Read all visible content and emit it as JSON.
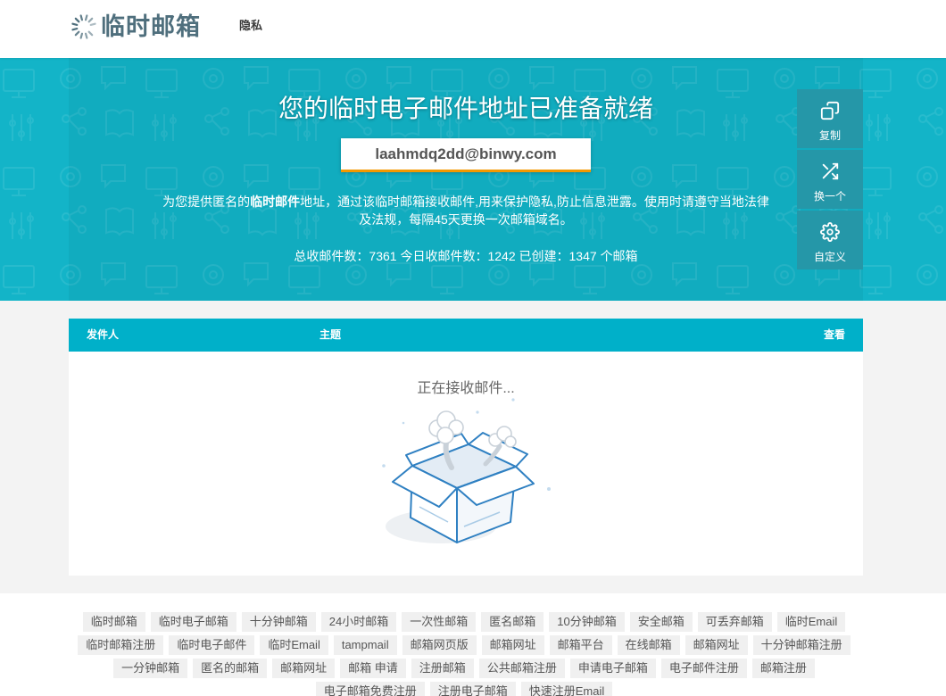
{
  "theme": {
    "accent": "#00b0c9",
    "hero_bg": "#13b4c8",
    "action_bg": "#2597a8",
    "email_underline": "#f39800",
    "logo_color": "#4f6f7d",
    "section_bg": "#f3f3f3",
    "tag_bg": "#f0f0f0"
  },
  "header": {
    "logo": {
      "text": "临时邮箱",
      "icon": "logo-spinner-icon"
    },
    "nav": [
      {
        "label": "隐私"
      }
    ]
  },
  "hero": {
    "title": "您的临时电子邮件地址已准备就绪",
    "email_address": "laahmdq2dd@binwy.com",
    "description": {
      "before": "为您提供匿名的",
      "highlight": "临时邮件",
      "after": "地址，通过该临时邮箱接收邮件,用来保护隐私,防止信息泄露。使用时请遵守当地法律及法规，每隔45天更换一次邮箱域名。"
    },
    "stats": {
      "total_label": "总收邮件数：",
      "total": "7361",
      "today_label": "今日收邮件数：",
      "today": "1242",
      "created_label": "已创建：",
      "created": "1347",
      "created_unit": "个邮箱"
    },
    "actions": [
      {
        "label": "复制",
        "icon": "copy-icon"
      },
      {
        "label": "换一个",
        "icon": "shuffle-icon"
      },
      {
        "label": "自定义",
        "icon": "gear-icon"
      }
    ]
  },
  "inbox": {
    "columns": {
      "sender": "发件人",
      "subject": "主题",
      "view": "查看"
    },
    "status": "正在接收邮件..."
  },
  "footer": {
    "tags": [
      "临时邮箱",
      "临时电子邮箱",
      "十分钟邮箱",
      "24小时邮箱",
      "一次性邮箱",
      "匿名邮箱",
      "10分钟邮箱",
      "安全邮箱",
      "可丢弃邮箱",
      "临时Email",
      "临时邮箱注册",
      "临时电子邮件",
      "临时Email",
      "tampmail",
      "邮箱网页版",
      "邮箱网址",
      "邮箱平台",
      "在线邮箱",
      "邮箱网址",
      "十分钟邮箱注册",
      "一分钟邮箱",
      "匿名的邮箱",
      "邮箱网址",
      "邮箱 申请",
      "注册邮箱",
      "公共邮箱注册",
      "申请电子邮箱",
      "电子邮件注册",
      "邮箱注册",
      "电子邮箱免费注册",
      "注册电子邮箱",
      "快速注册Email"
    ]
  }
}
